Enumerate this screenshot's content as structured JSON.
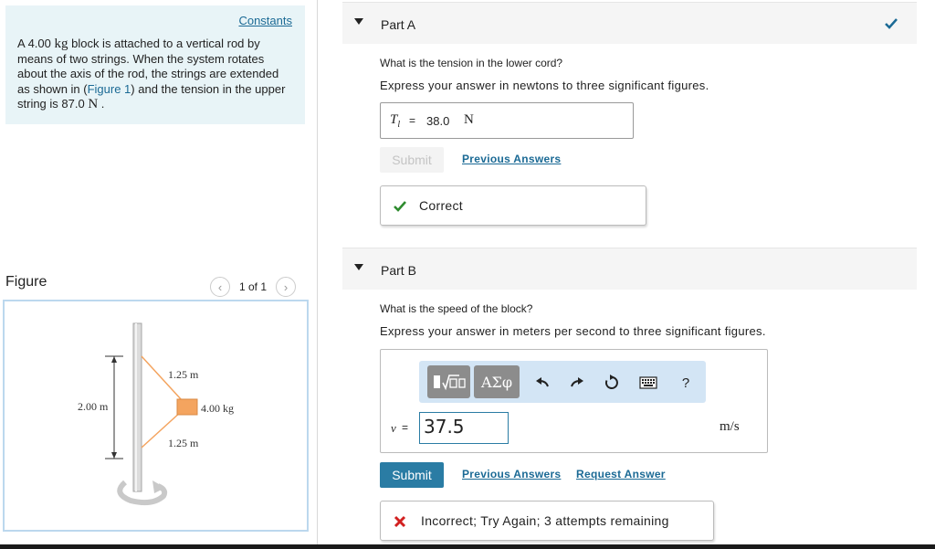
{
  "problem": {
    "constants_link": "Constants",
    "text_1": "A 4.00 ",
    "mass_unit": "kg",
    "text_2": " block is attached to a vertical rod by means of two strings. When the system rotates about the axis of the rod, the strings are extended as shown in (",
    "figure_link": "Figure 1",
    "text_3": ") and the tension in the upper string is 87.0 ",
    "tension_unit": "N",
    "text_4": " ."
  },
  "figure": {
    "label": "Figure",
    "count": "1 of 1",
    "prev_icon": "chevron-left-icon",
    "next_icon": "chevron-right-icon",
    "labels": {
      "height": "2.00 m",
      "upper_string": "1.25 m",
      "lower_string": "1.25 m",
      "mass": "4.00 kg"
    },
    "colors": {
      "block": "#f4a45f",
      "string": "#f4a45f",
      "rod": "#d8d8d8"
    }
  },
  "part_a": {
    "title": "Part A",
    "question": "What is the tension in the lower cord?",
    "instruction": "Express your answer in newtons to three significant figures.",
    "answer_var": "T",
    "answer_sub": "l",
    "answer_eq": "=",
    "answer_value": "38.0",
    "answer_unit": "N",
    "submit_label": "Submit",
    "previous_answers": "Previous Answers",
    "feedback": "Correct",
    "status_icon": "checkmark-icon"
  },
  "part_b": {
    "title": "Part B",
    "question": "What is the speed of the block?",
    "instruction": "Express your answer in meters per second to three significant figures.",
    "toolbar": {
      "templates_icon": "templates-sqrt-icon",
      "symbols_label": "ΑΣφ",
      "undo_icon": "undo-icon",
      "redo_icon": "redo-icon",
      "reset_icon": "reset-icon",
      "keyboard_icon": "keyboard-icon",
      "help_label": "?"
    },
    "answer_var": "v",
    "answer_eq": "=",
    "answer_value": "37.5",
    "answer_unit": "m/s",
    "submit_label": "Submit",
    "previous_answers": "Previous Answers",
    "request_answer": "Request Answer",
    "feedback": "Incorrect; Try Again; 3 attempts remaining"
  },
  "colors": {
    "accent": "#2a7ca4",
    "link": "#1b6a95",
    "correct": "#2e8b2e",
    "incorrect": "#d22020",
    "problem_bg": "#e8f4f7"
  }
}
